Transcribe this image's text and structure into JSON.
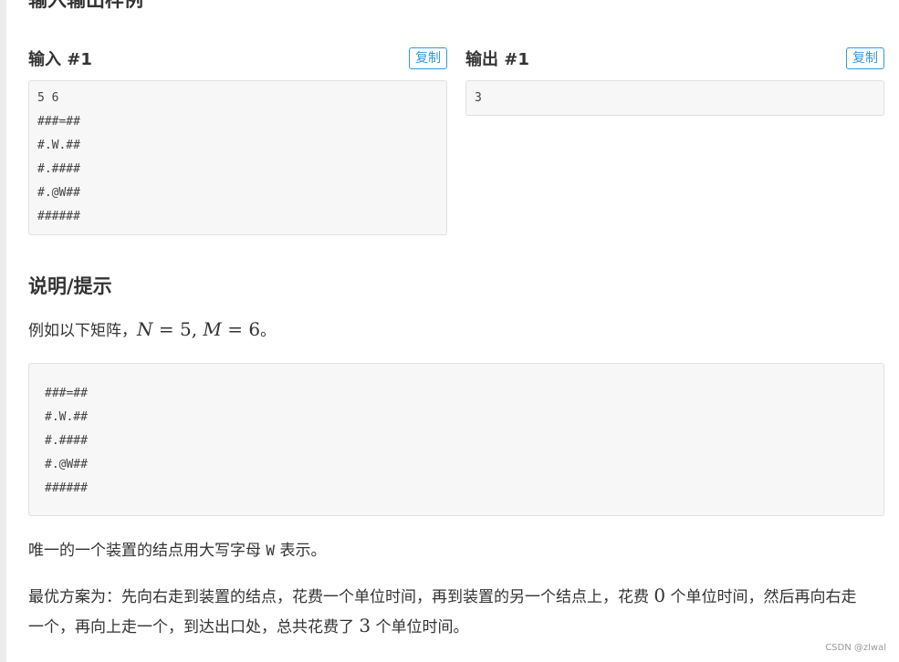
{
  "section_title": "输入输出样例",
  "samples": {
    "input_label": "输入 #1",
    "output_label": "输出 #1",
    "copy_label": "复制",
    "input_lines": [
      "5 6",
      "###=##",
      "#.W.##",
      "#.####",
      "#.@W##",
      "######"
    ],
    "output_lines": [
      "3"
    ]
  },
  "hint": {
    "title": "说明/提示",
    "intro_prefix": "例如以下矩阵，",
    "intro_math_N": "N",
    "intro_math_eq1": " = 5, ",
    "intro_math_M": "M",
    "intro_math_eq2": " = 6",
    "intro_suffix": "。",
    "matrix_lines": [
      "###=##",
      "#.W.##",
      "#.####",
      "#.@W##",
      "######"
    ],
    "p2_prefix": "唯一的一个装置的结点用大写字母 ",
    "p2_code": "W",
    "p2_suffix": " 表示。",
    "p3_part1": "最优方案为：先向右走到装置的结点，花费一个单位时间，再到装置的另一个结点上，花费 ",
    "p3_num1": "0",
    "p3_part2": " 个单位时间，然后再向右走一个，再向上走一个，到达出口处，总共花费了 ",
    "p3_num2": "3",
    "p3_part3": " 个单位时间。"
  },
  "watermark": "CSDN @zlwal",
  "colors": {
    "accent": "#3498db",
    "code_bg": "#f7f7f7"
  }
}
